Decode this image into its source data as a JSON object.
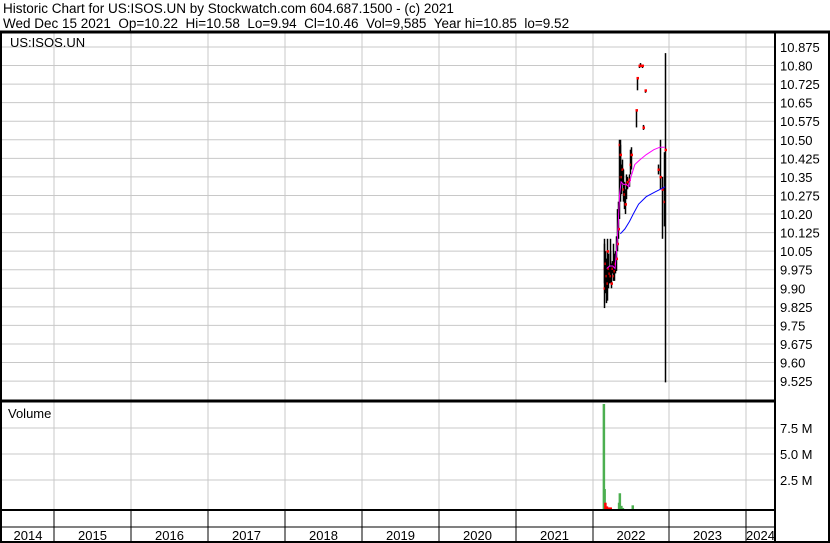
{
  "header": {
    "title": "Historic Chart for US:ISOS.UN by Stockwatch.com 604.687.1500 - (c) 2021",
    "quote": "Wed Dec 15 2021  Op=10.22  Hi=10.58  Lo=9.94  Cl=10.46  Vol=9,585  Year hi=10.85  lo=9.52"
  },
  "chart_data": {
    "type": "line",
    "symbol": "US:ISOS.UN",
    "volume_label": "Volume",
    "x_tick_labels": [
      "2014",
      "2015",
      "2016",
      "2017",
      "2018",
      "2019",
      "2020",
      "2021",
      "2022",
      "2023",
      "2024"
    ],
    "price_ticks": [
      "10.875",
      "10.80",
      "10.725",
      "10.65",
      "10.575",
      "10.50",
      "10.425",
      "10.35",
      "10.275",
      "10.20",
      "10.125",
      "10.05",
      "9.975",
      "9.90",
      "9.825",
      "9.75",
      "9.675",
      "9.60",
      "9.525"
    ],
    "price_range": [
      9.475,
      10.9
    ],
    "volume_ticks": [
      "7.5 M",
      "5.0 M",
      "2.5 M"
    ],
    "volume_range": [
      0,
      10000000
    ],
    "colors": {
      "bar": "#000000",
      "close": "#ff0000",
      "ma_short": "#ff00ff",
      "ma_long": "#0000ff",
      "volume_up": "#4caf50",
      "volume_down": "#ff0000",
      "grid": "#c8c8c8"
    },
    "bars": [
      [
        2021.14,
        10.08,
        9.92,
        9.98
      ],
      [
        2021.15,
        10.1,
        9.82,
        9.9
      ],
      [
        2021.16,
        10.05,
        9.88,
        10.0
      ],
      [
        2021.17,
        10.02,
        9.84,
        9.95
      ],
      [
        2021.18,
        10.1,
        9.9,
        10.05
      ],
      [
        2021.19,
        10.0,
        9.85,
        9.92
      ],
      [
        2021.2,
        10.04,
        9.9,
        9.98
      ],
      [
        2021.21,
        9.99,
        9.92,
        9.96
      ],
      [
        2021.22,
        10.1,
        9.92,
        9.95
      ],
      [
        2021.23,
        10.05,
        9.93,
        9.95
      ],
      [
        2021.24,
        10.0,
        9.9,
        9.92
      ],
      [
        2021.25,
        10.01,
        9.96,
        9.98
      ],
      [
        2021.26,
        10.08,
        9.93,
        9.95
      ],
      [
        2021.27,
        10.04,
        9.93,
        9.97
      ],
      [
        2021.29,
        10.05,
        9.96,
        10.0
      ],
      [
        2021.3,
        10.11,
        9.97,
        10.02
      ],
      [
        2021.32,
        10.22,
        10.05,
        10.08
      ],
      [
        2021.33,
        10.25,
        10.1,
        10.14
      ],
      [
        2021.34,
        10.5,
        10.18,
        10.48
      ],
      [
        2021.35,
        10.5,
        10.25,
        10.35
      ],
      [
        2021.36,
        10.48,
        10.3,
        10.44
      ],
      [
        2021.37,
        10.4,
        10.28,
        10.35
      ],
      [
        2021.38,
        10.42,
        10.32,
        10.38
      ],
      [
        2021.39,
        10.38,
        10.25,
        10.3
      ],
      [
        2021.41,
        10.33,
        10.22,
        10.28
      ],
      [
        2021.42,
        10.3,
        10.2,
        10.24
      ],
      [
        2021.43,
        10.36,
        10.26,
        10.32
      ],
      [
        2021.45,
        10.35,
        10.3,
        10.33
      ],
      [
        2021.47,
        10.36,
        10.31,
        10.34
      ],
      [
        2021.49,
        10.46,
        10.36,
        10.4
      ],
      [
        2021.5,
        10.47,
        10.38,
        10.44
      ],
      [
        2021.56,
        10.62,
        10.55,
        10.62
      ],
      [
        2021.58,
        10.75,
        10.7,
        10.75
      ],
      [
        2021.6,
        10.8,
        10.79,
        10.8
      ],
      [
        2021.62,
        10.81,
        10.8,
        10.8
      ],
      [
        2021.64,
        10.8,
        10.79,
        10.8
      ],
      [
        2021.66,
        10.56,
        10.54,
        10.55
      ],
      [
        2021.68,
        10.7,
        10.69,
        10.7
      ],
      [
        2021.85,
        10.4,
        10.36,
        10.38
      ],
      [
        2021.88,
        10.5,
        10.3,
        10.35
      ],
      [
        2021.91,
        10.35,
        10.1,
        10.3
      ],
      [
        2021.93,
        10.45,
        10.15,
        10.25
      ],
      [
        2021.95,
        10.85,
        9.52,
        10.46
      ]
    ],
    "ma_short": [
      [
        2021.18,
        9.98
      ],
      [
        2021.22,
        9.99
      ],
      [
        2021.26,
        9.99
      ],
      [
        2021.29,
        9.98
      ],
      [
        2021.31,
        10.05
      ],
      [
        2021.33,
        10.15
      ],
      [
        2021.35,
        10.28
      ],
      [
        2021.37,
        10.33
      ],
      [
        2021.4,
        10.32
      ],
      [
        2021.44,
        10.32
      ],
      [
        2021.47,
        10.31
      ],
      [
        2021.5,
        10.35
      ],
      [
        2021.55,
        10.4
      ],
      [
        2021.62,
        10.42
      ],
      [
        2021.7,
        10.44
      ],
      [
        2021.8,
        10.46
      ],
      [
        2021.88,
        10.47
      ],
      [
        2021.95,
        10.47
      ]
    ],
    "ma_long": [
      [
        2021.36,
        10.12
      ],
      [
        2021.42,
        10.14
      ],
      [
        2021.48,
        10.17
      ],
      [
        2021.53,
        10.2
      ],
      [
        2021.6,
        10.24
      ],
      [
        2021.7,
        10.27
      ],
      [
        2021.82,
        10.29
      ],
      [
        2021.95,
        10.31
      ]
    ],
    "volume": [
      [
        2021.14,
        10000000,
        "up"
      ],
      [
        2021.15,
        1900000,
        "up"
      ],
      [
        2021.16,
        600000,
        "down"
      ],
      [
        2021.18,
        250000,
        "down"
      ],
      [
        2021.21,
        150000,
        "down"
      ],
      [
        2021.23,
        150000,
        "down"
      ],
      [
        2021.34,
        600000,
        "up"
      ],
      [
        2021.35,
        1500000,
        "up"
      ],
      [
        2021.37,
        300000,
        "up"
      ],
      [
        2021.39,
        100000,
        "up"
      ],
      [
        2021.52,
        350000,
        "up"
      ]
    ]
  }
}
